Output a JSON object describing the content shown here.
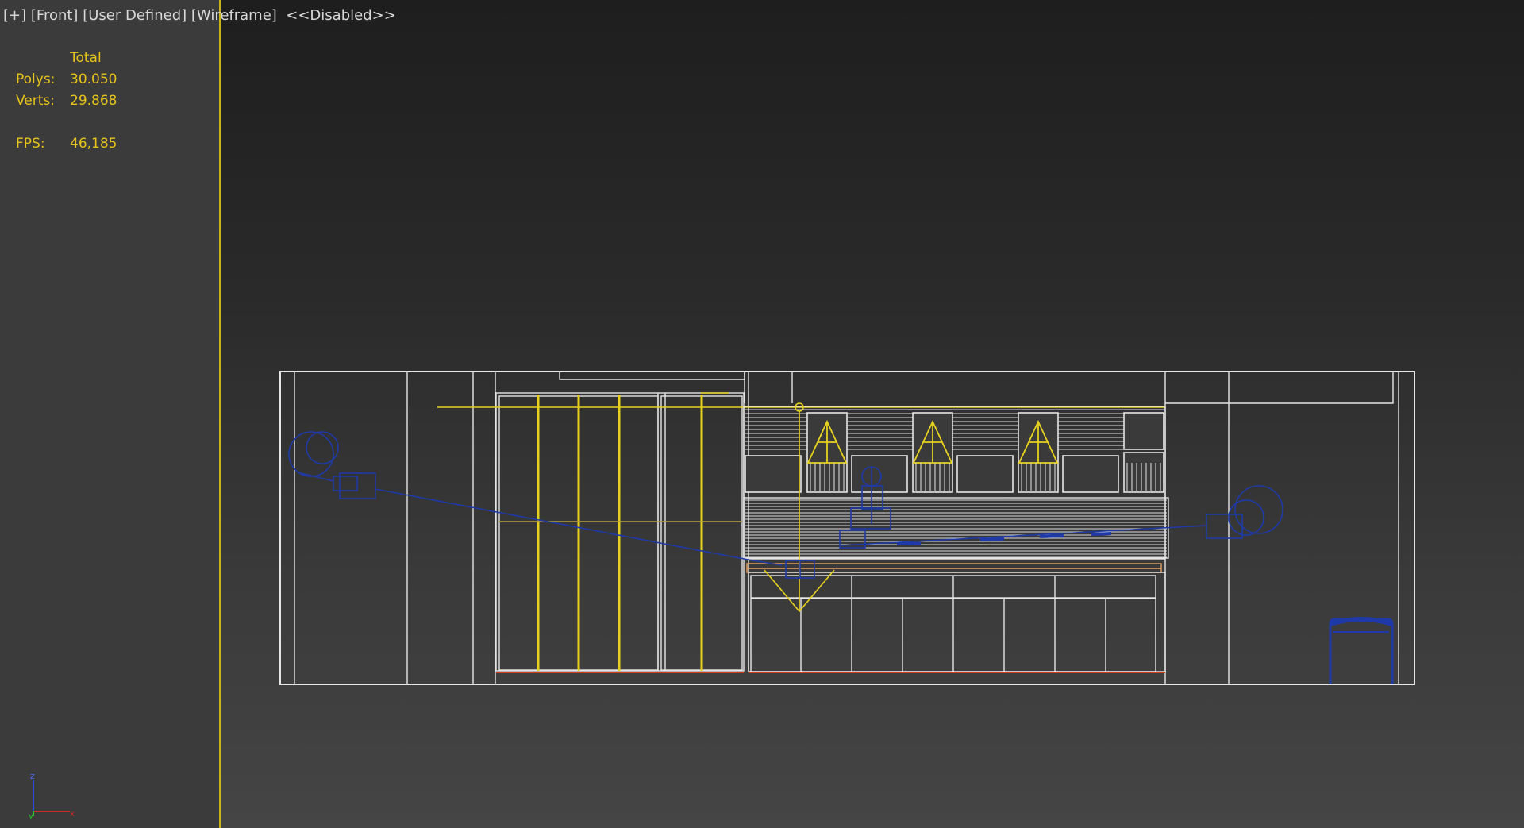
{
  "viewport": {
    "labels": [
      "[+]",
      "[Front]",
      "[User Defined]",
      "[Wireframe]",
      "<<Disabled>>"
    ]
  },
  "stats": {
    "header": "Total",
    "polys_label": "Polys:",
    "polys_value": "30.050",
    "verts_label": "Verts:",
    "verts_value": "29.868",
    "fps_label": "FPS:",
    "fps_value": "46,185"
  },
  "axis": {
    "z": "z",
    "y": "y",
    "x": "x"
  },
  "colors": {
    "wire_white": "#e6e6e6",
    "wire_yellow": "#e6d21e",
    "wire_blue": "#1f3aa8",
    "wire_red": "#c8401e",
    "wire_orange": "#e6a060",
    "stats_text": "#e6c419"
  }
}
